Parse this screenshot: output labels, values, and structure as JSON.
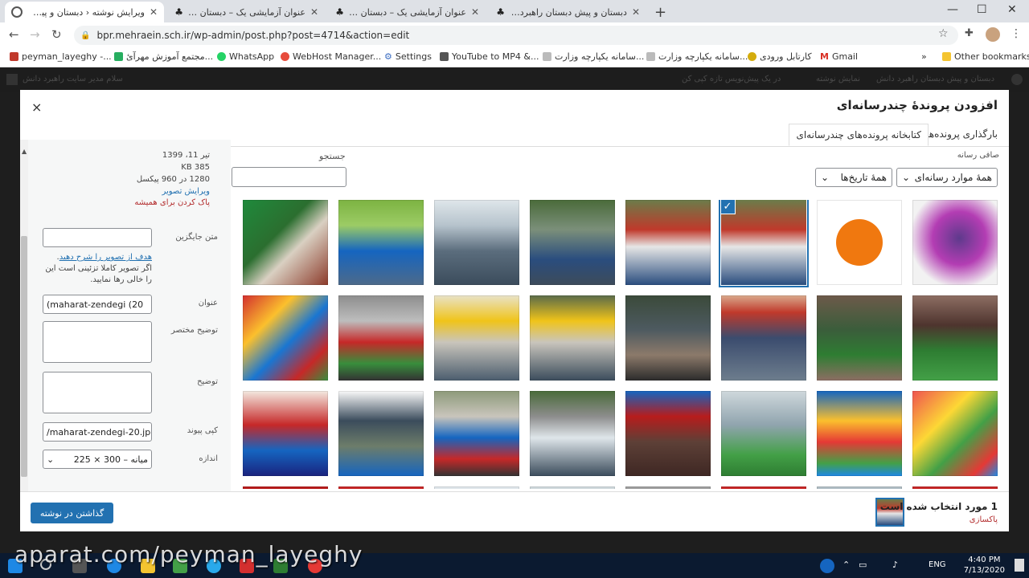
{
  "browser": {
    "tabs": [
      {
        "title": "ویرایش نوشته ‹ دبستان و پیش دبستان",
        "active": true
      },
      {
        "title": "عنوان آزمایشی یک – دبستان و پیش",
        "active": false
      },
      {
        "title": "عنوان آزمایشی یک – دبستان و پیش",
        "active": false
      },
      {
        "title": "دبستان و پیش دبستان راهبرد دانش",
        "active": false
      }
    ],
    "new_tab": "+",
    "url": "bpr.mehraein.sch.ir/wp-admin/post.php?post=4714&action=edit",
    "bookmarks": [
      {
        "label": "peyman_layeghy -...",
        "color": "#c0392b"
      },
      {
        "label": "مجتمع آموزش مهرآئ...",
        "color": "#27ae60"
      },
      {
        "label": "WhatsApp",
        "color": "#25d366"
      },
      {
        "label": "WebHost Manager...",
        "color": "#e74c3c"
      },
      {
        "label": "Settings",
        "color": "#3c6ec2"
      },
      {
        "label": "YouTube to MP4 &...",
        "color": "#555555"
      },
      {
        "label": "سامانه یکپارچه وزارت...",
        "color": "#999999"
      },
      {
        "label": "سامانه یکپارچه وزارت...",
        "color": "#999999"
      },
      {
        "label": "کارتابل ورودی",
        "color": "#d4ac0d"
      },
      {
        "label": "Gmail",
        "color": "#d93025"
      }
    ],
    "more_bookmarks": "»",
    "other_bookmarks": "Other bookmarks"
  },
  "adminbar": {
    "greeting": "سلام مدیر سایت راهبرد دانش",
    "site": "دبستان و پیش دبستان راهبرد دانش",
    "view_post": "نمایش نوشته",
    "preview_note": "در یک پیش‌نویس تازه کپی کن"
  },
  "modal": {
    "title": "افزودن پروندهٔ چندرسانه‌ای",
    "close": "×",
    "tabs": [
      {
        "label": "بارگذاری پرونده‌ها",
        "active": false
      },
      {
        "label": "کتابخانه پرونده‌های چندرسانه‌ای",
        "active": true
      }
    ],
    "filter_label": "صافی رسانه",
    "filter_type": "همهٔ موارد رسانه‌ای",
    "filter_date": "همهٔ تاریخ‌ها",
    "search_label": "جستجو",
    "search_value": ""
  },
  "attachment": {
    "date": "تیر 11، 1399",
    "size": "385 KB",
    "dimensions": "1280 در 960 پیکسل",
    "edit_link": "ویرایش تصویر",
    "delete_link": "پاک کردن برای همیشه",
    "alt_label": "متن جایگزین",
    "alt_value": "",
    "alt_help_link": "هدف از تصویر را شرح دهید",
    "alt_help_text": ". اگر تصویر کاملا تزئینی است این را خالی رها نمایید.",
    "title_label": "عنوان",
    "title_value": "(maharat-zendegi (20",
    "caption_label": "توضیح مختصر",
    "caption_value": "",
    "description_label": "توضیح",
    "description_value": "",
    "copy_link_label": "کپی پیوند",
    "copy_link_value": "/maharat-zendegi-20.jpg'",
    "size_label": "اندازه",
    "size_value": "میانه – 300 × 225"
  },
  "footer": {
    "selected_count": "1 مورد انتخاب شده است",
    "clear": "پاکسازی",
    "insert_button": "گذاشتن در نوشته"
  },
  "taskbar": {
    "lang": "ENG",
    "time": "4:40 PM",
    "date": "7/13/2020"
  },
  "watermark": "aparat.com/peyman_layeghy",
  "colors": {
    "accent": "#2271b1",
    "danger": "#b32d2e"
  }
}
